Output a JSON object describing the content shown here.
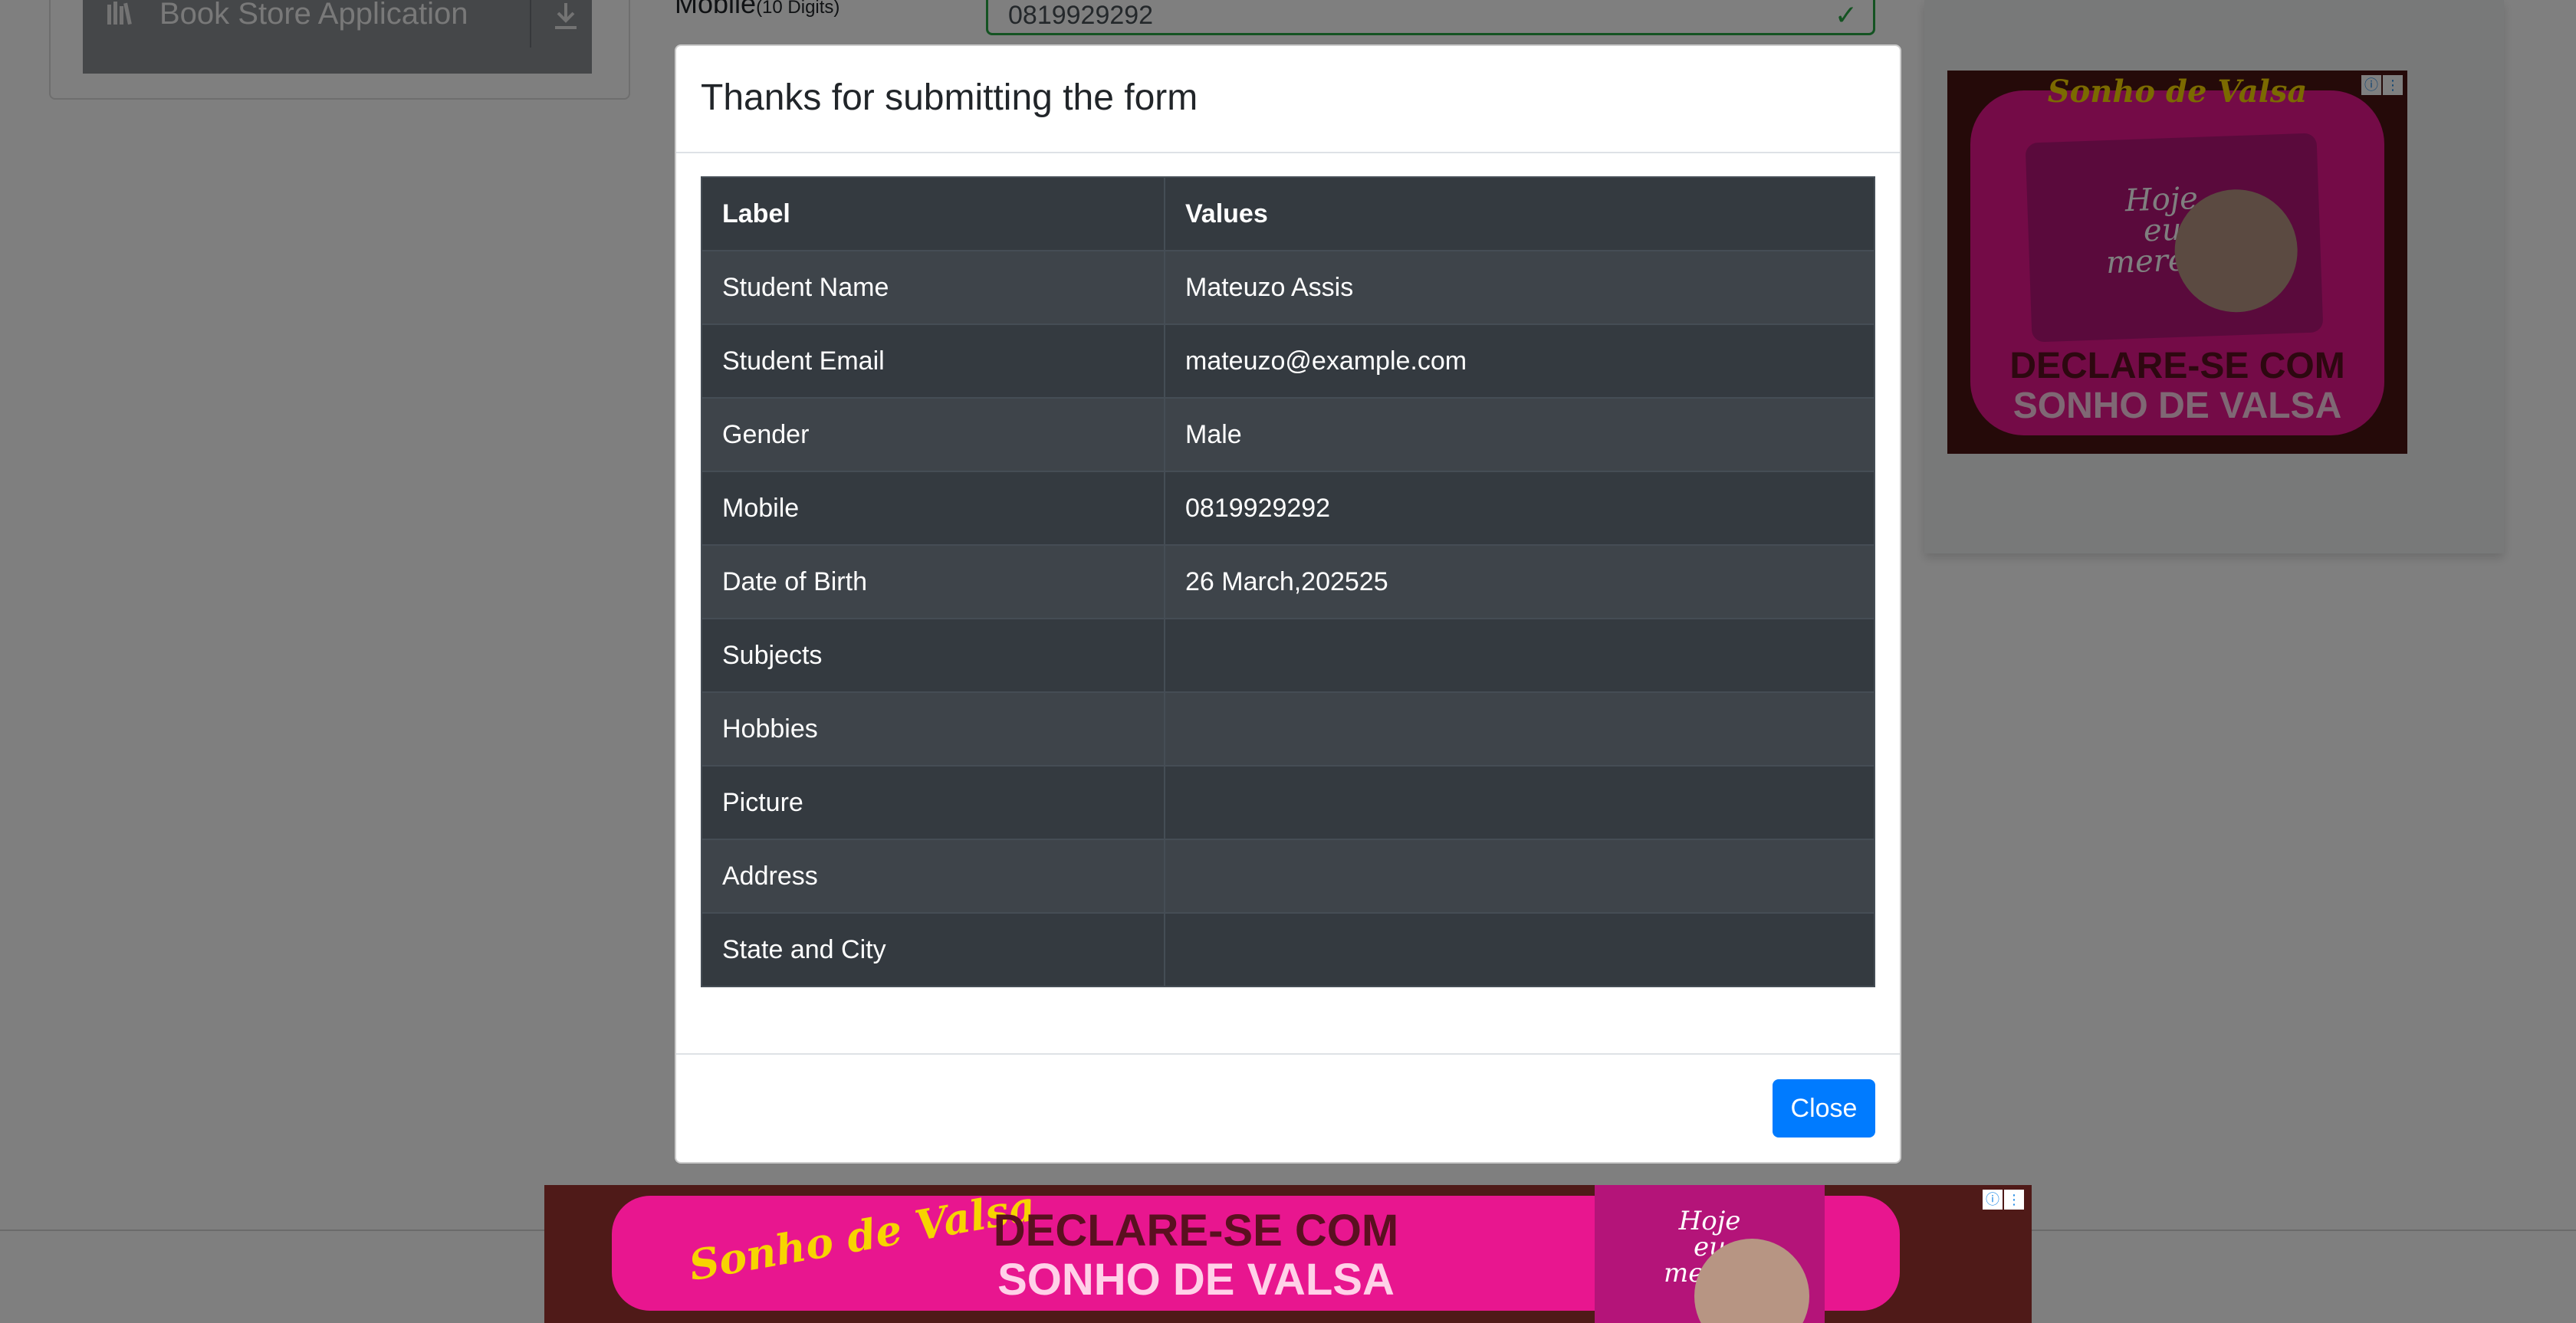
{
  "background": {
    "sidebar": {
      "active_item_label": "Book Store Application"
    },
    "form": {
      "mobile_label": "Mobile",
      "mobile_hint": "(10 Digits)",
      "mobile_value": "0819929292"
    },
    "side_ad": {
      "brand": "Sonho de Valsa",
      "pack_text": "Hoje eu mereço",
      "headline_line1": "DECLARE-SE COM",
      "headline_line2": "SONHO DE VALSA"
    }
  },
  "modal": {
    "title": "Thanks for submitting the form",
    "table": {
      "headers": [
        "Label",
        "Values"
      ],
      "rows": [
        {
          "label": "Student Name",
          "value": "Mateuzo Assis"
        },
        {
          "label": "Student Email",
          "value": "mateuzo@example.com"
        },
        {
          "label": "Gender",
          "value": "Male"
        },
        {
          "label": "Mobile",
          "value": "0819929292"
        },
        {
          "label": "Date of Birth",
          "value": "26 March,202525"
        },
        {
          "label": "Subjects",
          "value": ""
        },
        {
          "label": "Hobbies",
          "value": ""
        },
        {
          "label": "Picture",
          "value": ""
        },
        {
          "label": "Address",
          "value": ""
        },
        {
          "label": "State and City",
          "value": ""
        }
      ]
    },
    "close_label": "Close"
  },
  "banner_ad": {
    "brand": "Sonho de Valsa",
    "headline_line1": "DECLARE-SE COM",
    "headline_line2": "SONHO DE VALSA",
    "pack_text": "Hoje eu mereço"
  },
  "colors": {
    "primary_button": "#007bff",
    "table_dark": "#343a40",
    "success_border": "#28a745",
    "ad_pink": "#e8168f"
  },
  "icons": [
    "book-icon",
    "download-icon",
    "check-icon",
    "ad-info-icon",
    "ad-options-icon"
  ]
}
